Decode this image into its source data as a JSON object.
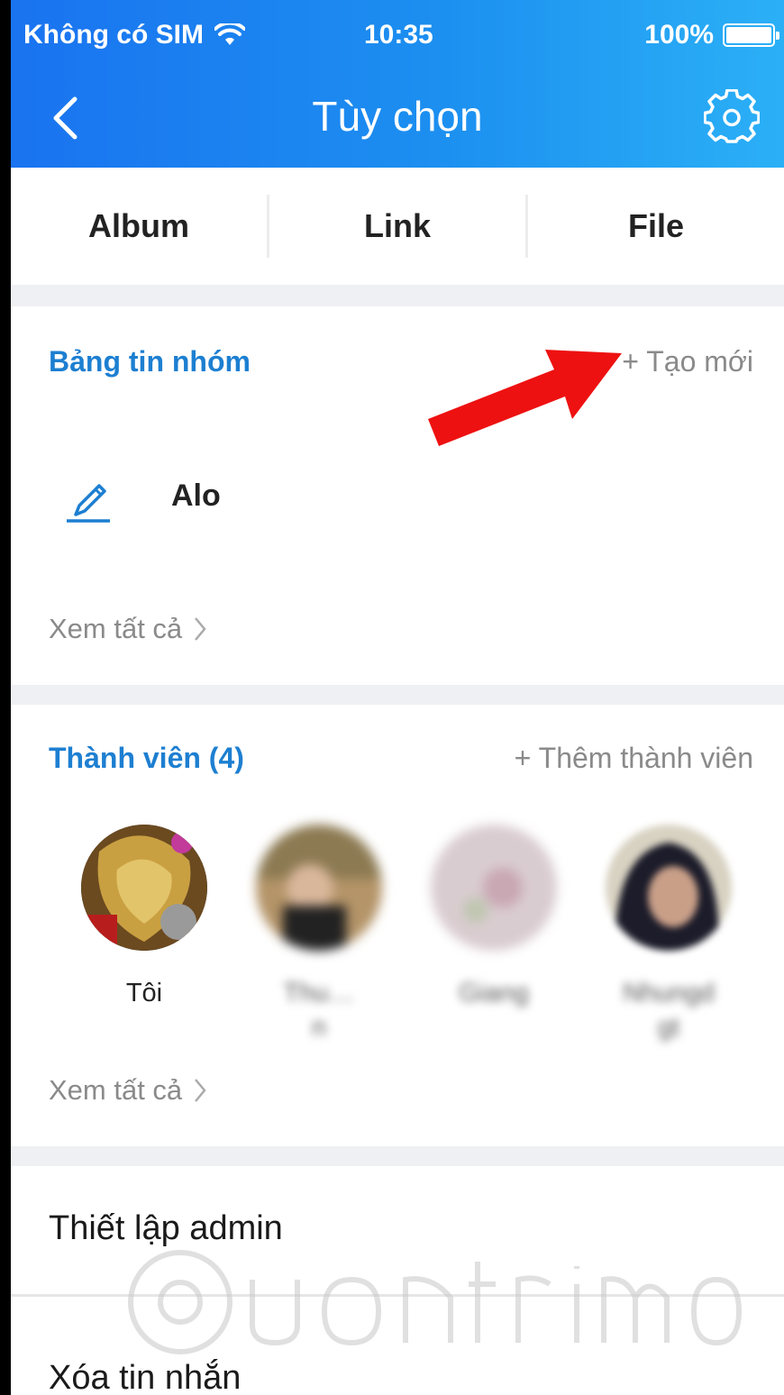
{
  "status_bar": {
    "carrier": "Không có SIM",
    "time": "10:35",
    "battery": "100%"
  },
  "navbar": {
    "title": "Tùy chọn",
    "back_icon": "chevron-left-icon",
    "settings_icon": "gear-icon"
  },
  "tabs": [
    {
      "label": "Album"
    },
    {
      "label": "Link"
    },
    {
      "label": "File"
    }
  ],
  "group_board": {
    "title": "Bảng tin nhóm",
    "action": "+ Tạo mới",
    "note_text": "Alo",
    "see_all": "Xem tất cả"
  },
  "members": {
    "title": "Thành viên (4)",
    "action": "+ Thêm thành viên",
    "list": [
      {
        "name": "Tôi"
      },
      {
        "name": "Thu…\nn"
      },
      {
        "name": "Giang"
      },
      {
        "name": "Nhungd\ngt"
      }
    ],
    "see_all": "Xem tất cả"
  },
  "menu": {
    "admin_settings": "Thiết lập admin",
    "delete_messages": "Xóa tin nhắn"
  },
  "colors": {
    "header_start": "#1a73f0",
    "header_end": "#2bb0f6",
    "accent_blue": "#1d7fd1",
    "annotation_arrow": "#ee1111"
  }
}
